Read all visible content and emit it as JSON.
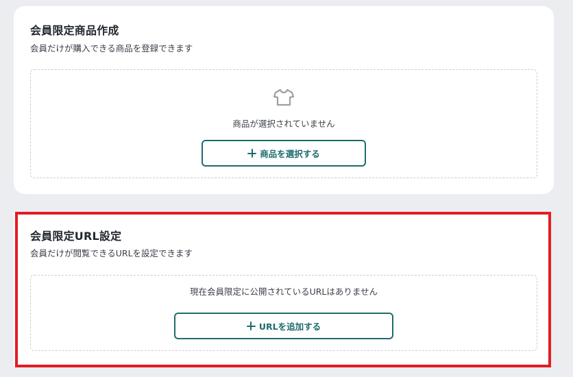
{
  "product_card": {
    "title": "会員限定商品作成",
    "description": "会員だけが購入できる商品を登録できます",
    "empty_message": "商品が選択されていません",
    "empty_icon": "shirt-icon",
    "button_label": "商品を選択する",
    "button_icon": "plus-icon"
  },
  "url_card": {
    "title": "会員限定URL設定",
    "description": "会員だけが閲覧できるURLを設定できます",
    "empty_message": "現在会員限定に公開されているURLはありません",
    "button_label": "URLを追加する",
    "button_icon": "plus-icon",
    "highlight_color": "#e31c23"
  },
  "colors": {
    "background": "#ecedf0",
    "card": "#ffffff",
    "accent": "#1c6b6d",
    "highlight": "#e31c23",
    "dashed_border": "#c9ccd1"
  }
}
